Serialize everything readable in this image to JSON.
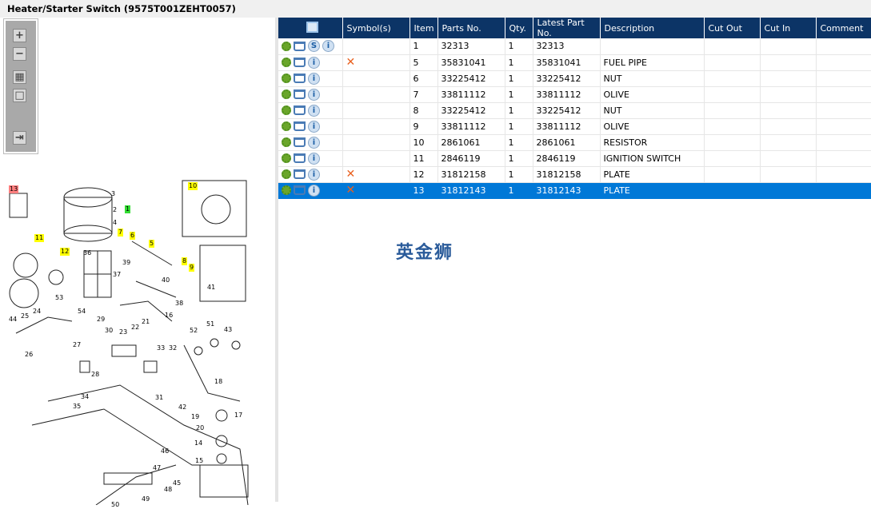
{
  "title": "Heater/Starter Switch (9575T001ZEHT0057)",
  "toolbar": {
    "zoom_in": "+",
    "zoom_out": "−",
    "fit": "▦",
    "actual": "□",
    "export": "⇥"
  },
  "callouts": [
    {
      "label": "13",
      "hl": "r"
    },
    {
      "label": "3",
      "hl": ""
    },
    {
      "label": "2",
      "hl": ""
    },
    {
      "label": "1",
      "hl": "g"
    },
    {
      "label": "4",
      "hl": ""
    },
    {
      "label": "10",
      "hl": "y"
    },
    {
      "label": "11",
      "hl": "y"
    },
    {
      "label": "7",
      "hl": "y"
    },
    {
      "label": "6",
      "hl": "y"
    },
    {
      "label": "5",
      "hl": "y"
    },
    {
      "label": "12",
      "hl": "y"
    },
    {
      "label": "36",
      "hl": ""
    },
    {
      "label": "39",
      "hl": ""
    },
    {
      "label": "8",
      "hl": "y"
    },
    {
      "label": "9",
      "hl": "y"
    },
    {
      "label": "40",
      "hl": ""
    },
    {
      "label": "37",
      "hl": ""
    },
    {
      "label": "41",
      "hl": ""
    },
    {
      "label": "53",
      "hl": ""
    },
    {
      "label": "38",
      "hl": ""
    },
    {
      "label": "54",
      "hl": ""
    },
    {
      "label": "16",
      "hl": ""
    },
    {
      "label": "44",
      "hl": ""
    },
    {
      "label": "25",
      "hl": ""
    },
    {
      "label": "24",
      "hl": ""
    },
    {
      "label": "29",
      "hl": ""
    },
    {
      "label": "21",
      "hl": ""
    },
    {
      "label": "22",
      "hl": ""
    },
    {
      "label": "30",
      "hl": ""
    },
    {
      "label": "23",
      "hl": ""
    },
    {
      "label": "52",
      "hl": ""
    },
    {
      "label": "51",
      "hl": ""
    },
    {
      "label": "43",
      "hl": ""
    },
    {
      "label": "27",
      "hl": ""
    },
    {
      "label": "33",
      "hl": ""
    },
    {
      "label": "32",
      "hl": ""
    },
    {
      "label": "26",
      "hl": ""
    },
    {
      "label": "28",
      "hl": ""
    },
    {
      "label": "18",
      "hl": ""
    },
    {
      "label": "34",
      "hl": ""
    },
    {
      "label": "31",
      "hl": ""
    },
    {
      "label": "42",
      "hl": ""
    },
    {
      "label": "35",
      "hl": ""
    },
    {
      "label": "17",
      "hl": ""
    },
    {
      "label": "19",
      "hl": ""
    },
    {
      "label": "20",
      "hl": ""
    },
    {
      "label": "14",
      "hl": ""
    },
    {
      "label": "46",
      "hl": ""
    },
    {
      "label": "15",
      "hl": ""
    },
    {
      "label": "47",
      "hl": ""
    },
    {
      "label": "48",
      "hl": ""
    },
    {
      "label": "45",
      "hl": ""
    },
    {
      "label": "49",
      "hl": ""
    },
    {
      "label": "50",
      "hl": ""
    }
  ],
  "table": {
    "headers": [
      "",
      "Symbol(s)",
      "Item",
      "Parts No.",
      "Qty.",
      "Latest Part No.",
      "Description",
      "Cut Out",
      "Cut In",
      "Comment"
    ],
    "rows": [
      {
        "item": "1",
        "part": "32313",
        "qty": "1",
        "latest": "32313",
        "desc": "",
        "symbol": "",
        "s_icon": true,
        "selected": false
      },
      {
        "item": "5",
        "part": "35831041",
        "qty": "1",
        "latest": "35831041",
        "desc": "FUEL PIPE",
        "symbol": "✕",
        "s_icon": false,
        "selected": false
      },
      {
        "item": "6",
        "part": "33225412",
        "qty": "1",
        "latest": "33225412",
        "desc": "NUT",
        "symbol": "",
        "s_icon": false,
        "selected": false
      },
      {
        "item": "7",
        "part": "33811112",
        "qty": "1",
        "latest": "33811112",
        "desc": "OLIVE",
        "symbol": "",
        "s_icon": false,
        "selected": false
      },
      {
        "item": "8",
        "part": "33225412",
        "qty": "1",
        "latest": "33225412",
        "desc": "NUT",
        "symbol": "",
        "s_icon": false,
        "selected": false
      },
      {
        "item": "9",
        "part": "33811112",
        "qty": "1",
        "latest": "33811112",
        "desc": "OLIVE",
        "symbol": "",
        "s_icon": false,
        "selected": false
      },
      {
        "item": "10",
        "part": "2861061",
        "qty": "1",
        "latest": "2861061",
        "desc": "RESISTOR",
        "symbol": "",
        "s_icon": false,
        "selected": false
      },
      {
        "item": "11",
        "part": "2846119",
        "qty": "1",
        "latest": "2846119",
        "desc": "IGNITION SWITCH",
        "symbol": "",
        "s_icon": false,
        "selected": false
      },
      {
        "item": "12",
        "part": "31812158",
        "qty": "1",
        "latest": "31812158",
        "desc": "PLATE",
        "symbol": "✕",
        "s_icon": false,
        "selected": false
      },
      {
        "item": "13",
        "part": "31812143",
        "qty": "1",
        "latest": "31812143",
        "desc": "PLATE",
        "symbol": "✕",
        "s_icon": false,
        "selected": true
      }
    ]
  },
  "watermark": "英金狮",
  "colors": {
    "header": "#0c3466",
    "selected": "#0078d7",
    "symbol": "#e9601f"
  }
}
